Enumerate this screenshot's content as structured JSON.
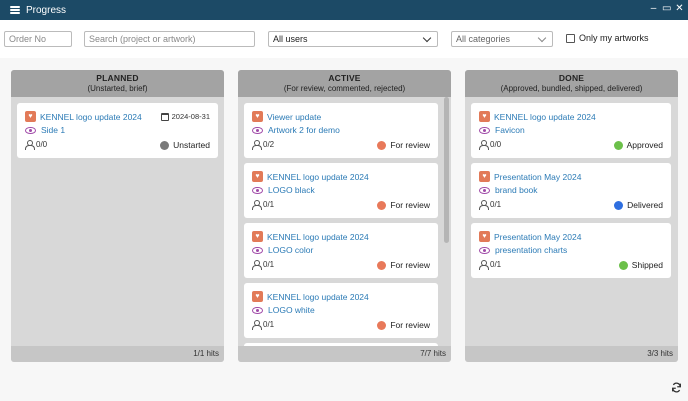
{
  "window": {
    "title": "Progress"
  },
  "toolbar": {
    "order_placeholder": "Order No",
    "search_placeholder": "Search (project or artwork)",
    "users_value": "All users",
    "categories_value": "All categories",
    "only_mine_label": "Only my artworks"
  },
  "columns": [
    {
      "name": "PLANNED",
      "subtitle": "(Unstarted, brief)",
      "hits": "1/1 hits",
      "cards": [
        {
          "project": "KENNEL logo update 2024",
          "artwork": "Side 1",
          "users": "0/0",
          "status": "Unstarted",
          "status_color": "#7a7a7a",
          "date": "2024-08-31"
        }
      ]
    },
    {
      "name": "ACTIVE",
      "subtitle": "(For review, commented, rejected)",
      "hits": "7/7 hits",
      "cards": [
        {
          "project": "Viewer update",
          "artwork": "Artwork 2 for demo",
          "users": "0/2",
          "status": "For review",
          "status_color": "#e8795a"
        },
        {
          "project": "KENNEL logo update 2024",
          "artwork": "LOGO black",
          "users": "0/1",
          "status": "For review",
          "status_color": "#e8795a"
        },
        {
          "project": "KENNEL logo update 2024",
          "artwork": "LOGO color",
          "users": "0/1",
          "status": "For review",
          "status_color": "#e8795a"
        },
        {
          "project": "KENNEL logo update 2024",
          "artwork": "LOGO white",
          "users": "0/1",
          "status": "For review",
          "status_color": "#e8795a"
        }
      ]
    },
    {
      "name": "DONE",
      "subtitle": "(Approved, bundled, shipped, delivered)",
      "hits": "3/3 hits",
      "cards": [
        {
          "project": "KENNEL logo update 2024",
          "artwork": "Favicon",
          "users": "0/0",
          "status": "Approved",
          "status_color": "#6cc04a"
        },
        {
          "project": "Presentation May 2024",
          "artwork": "brand book",
          "users": "0/1",
          "status": "Delivered",
          "status_color": "#2f6fe0"
        },
        {
          "project": "Presentation May 2024",
          "artwork": "presentation charts",
          "users": "0/1",
          "status": "Shipped",
          "status_color": "#6cc04a"
        }
      ]
    }
  ]
}
